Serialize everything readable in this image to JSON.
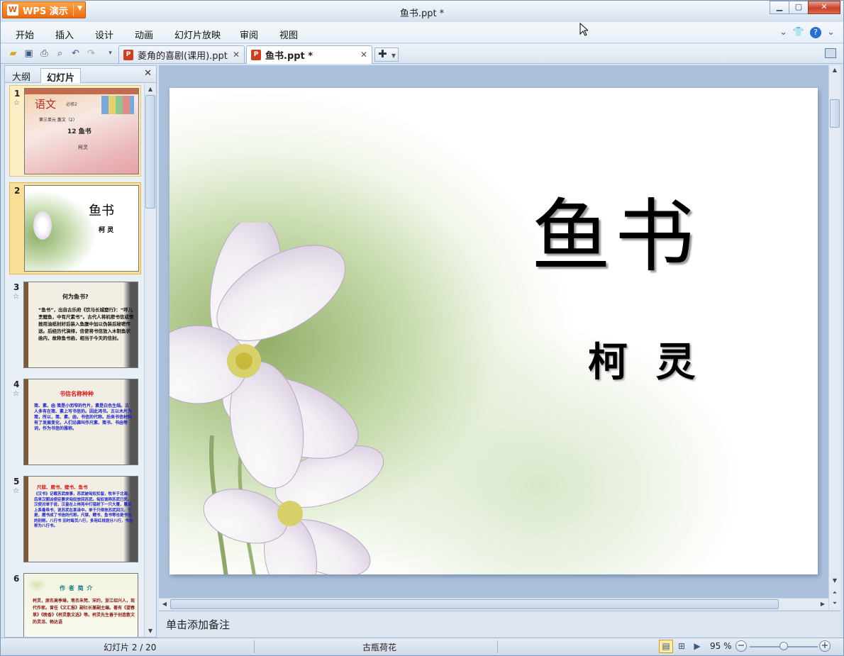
{
  "app": {
    "menu_button": "WPS 演示",
    "window_title": "鱼书.ppt *"
  },
  "menu": [
    "开始",
    "插入",
    "设计",
    "动画",
    "幻灯片放映",
    "审阅",
    "视图"
  ],
  "tabs": [
    {
      "label": "菱角的喜剧(课用).ppt"
    },
    {
      "label": "鱼书.ppt *"
    }
  ],
  "panel": {
    "tab_outline": "大纲",
    "tab_slides": "幻灯片"
  },
  "thumbnails": [
    {
      "num": "1",
      "title": "语文",
      "subtitle": "12 鱼书",
      "author": "柯灵",
      "unit": "第三单元  散文（2）",
      "book": "必修2"
    },
    {
      "num": "2",
      "title": "鱼书",
      "author": "柯 灵"
    },
    {
      "num": "3",
      "title": "何为鱼书?",
      "body": "“鱼书”，出自古乐府《饮马长城窟行》：“呼儿烹鲤鱼，中有尺素书”。古代人将机密书信或情报用油纸封好后装入鱼腹中加以伪装后秘密传送。后经历代演绎，信使将书信放入木制鱼状函内，故称鱼书函，相当于今天的信封。"
    },
    {
      "num": "4",
      "title": "书信名称种种",
      "body": "笺、素、函  笺是小而窄的竹片，素是白色生绢。古人多有在笺、素上写书信的。因此鸿书。古以木片为笺，所以，笺、素、函，书信的代称。后来书信材料有了发展变化，人们沿袭叫作尺素、笺书、书函等词，作为书信的雅称。"
    },
    {
      "num": "5",
      "title": "尺牍、雁书、鲤书、鱼书",
      "body": "《汉书》记载苏武故事，苏武被匈奴扣留，牧羊于北海，后来汉朝派使臣要求匈奴放回苏武。匈奴诡称苏武已死。汉使对单于说，汉皇在上林苑中打猎射下一只大雁，雁足上系着帛书，说苏武在某泽中。单于只得放苏武回汉。于是，雁书成了书信的代称。尺牍、鲤书、鱼书等也是书信的别称。八行书  旧时每页八行，多用红线划分八行，书信称为八行书。"
    },
    {
      "num": "6",
      "title": "作 者 简 介",
      "body": "柯灵，原名高季琳，笔名朱梵、宋约，浙江绍兴人，现代作家。曾任《文汇报》副社长兼副主编。著有《望春草》《晚香》《柯灵散文选》等。柯灵先生善于创造散文的灵活、畅达语"
    }
  ],
  "slide": {
    "title": "鱼书",
    "subtitle": "柯 灵"
  },
  "notes_placeholder": "单击添加备注",
  "status": {
    "slide_indicator": "幻灯片 2 / 20",
    "theme": "古瓶荷花",
    "zoom": "95 %",
    "zoom_level": 0.5
  },
  "colors": {
    "accent": "#e86a10",
    "selection": "#f9df96",
    "chrome": "#d7e3f1"
  }
}
